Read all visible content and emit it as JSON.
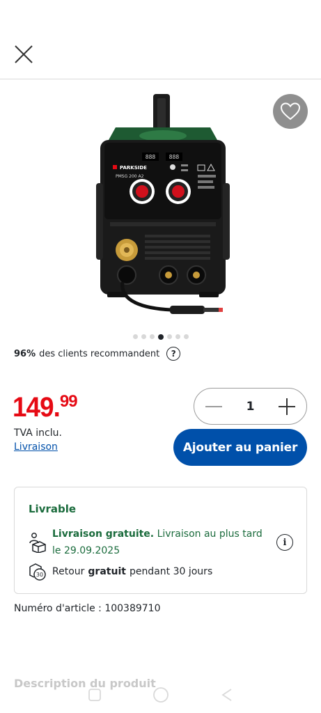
{
  "header": {
    "close_icon": "close-icon"
  },
  "gallery": {
    "favorite_icon": "heart-icon",
    "product_image_alt": "PARKSIDE PMSG 200 A2",
    "dots_count": 7,
    "active_dot": 3
  },
  "product_panel": {
    "brand_label": "PARKSIDE",
    "model_label": "PMSG 200 A2",
    "display_left": "888",
    "display_right": "888"
  },
  "recommend": {
    "percent": "96%",
    "text": "des clients recommandent",
    "help": "?"
  },
  "price": {
    "main": "149.",
    "cents": "99",
    "tva": "TVA inclu.",
    "delivery_link": "Livraison"
  },
  "quantity": {
    "value": "1",
    "minus_icon": "minus-icon",
    "plus_icon": "plus-icon"
  },
  "cart": {
    "add_label": "Ajouter au panier"
  },
  "availability": {
    "status": "Livrable",
    "shipping_bold": "Livraison gratuite.",
    "shipping_text": " Livraison au plus tard le 29.09.2025",
    "info": "i",
    "return_prefix": "Retour",
    "return_bold": "gratuit",
    "return_suffix": "pendant 30 jours",
    "return_days": "30"
  },
  "article": {
    "label": "Numéro d'article : 100389710"
  },
  "description": {
    "title": "Description du produit"
  },
  "colors": {
    "accent_blue": "#0050aa",
    "price_red": "#e60a14",
    "status_green": "#1a6b3c"
  }
}
